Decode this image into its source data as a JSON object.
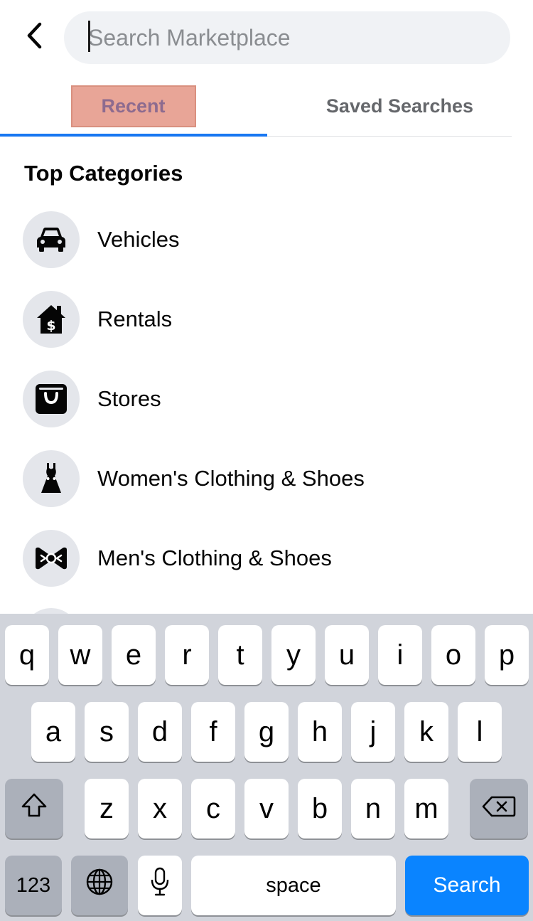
{
  "search": {
    "placeholder": "Search Marketplace"
  },
  "tabs": [
    {
      "label": "Recent",
      "active": true
    },
    {
      "label": "Saved Searches",
      "active": false
    }
  ],
  "section_title": "Top Categories",
  "categories": [
    {
      "label": "Vehicles",
      "icon": "car-icon"
    },
    {
      "label": "Rentals",
      "icon": "house-dollar-icon"
    },
    {
      "label": "Stores",
      "icon": "shopping-bag-icon"
    },
    {
      "label": "Women's Clothing & Shoes",
      "icon": "dress-icon"
    },
    {
      "label": "Men's Clothing & Shoes",
      "icon": "bow-tie-icon"
    }
  ],
  "keyboard": {
    "row1": [
      "q",
      "w",
      "e",
      "r",
      "t",
      "y",
      "u",
      "i",
      "o",
      "p"
    ],
    "row2": [
      "a",
      "s",
      "d",
      "f",
      "g",
      "h",
      "j",
      "k",
      "l"
    ],
    "row3": [
      "z",
      "x",
      "c",
      "v",
      "b",
      "n",
      "m"
    ],
    "numbers_label": "123",
    "space_label": "space",
    "action_label": "Search"
  },
  "colors": {
    "accent": "#1877f2",
    "search_key": "#0a84ff",
    "highlight": "#e8a597"
  }
}
